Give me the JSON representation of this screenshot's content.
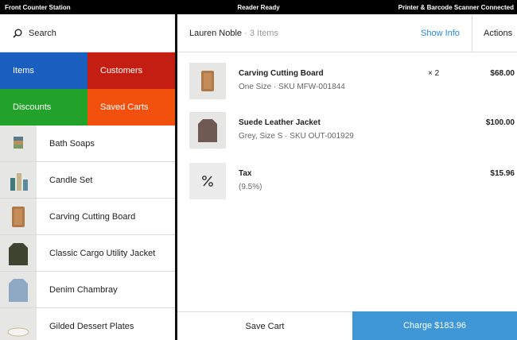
{
  "status_bar": {
    "left": "Front Counter Station",
    "center": "Reader Ready",
    "right": "Printer & Barcode Scanner Connected"
  },
  "search": {
    "label": "Search"
  },
  "tiles": {
    "items": "Items",
    "customers": "Customers",
    "discounts": "Discounts",
    "saved_carts": "Saved Carts"
  },
  "products": [
    {
      "name": "Bath Soaps"
    },
    {
      "name": "Candle Set"
    },
    {
      "name": "Carving Cutting Board"
    },
    {
      "name": "Classic Cargo Utility Jacket"
    },
    {
      "name": "Denim Chambray"
    },
    {
      "name": "Gilded Dessert Plates"
    }
  ],
  "cart": {
    "customer": "Lauren Noble",
    "item_count": " · 3 Items",
    "show_info": "Show Info",
    "actions": "Actions",
    "lines": [
      {
        "name": "Carving Cutting Board",
        "desc": "One Size · SKU MFW-001844",
        "qty": "× 2",
        "amount": "$68.00"
      },
      {
        "name": "Suede Leather Jacket",
        "desc": "Grey, Size S · SKU OUT-001929",
        "qty": "",
        "amount": "$100.00"
      },
      {
        "name": "Tax",
        "desc": "(9.5%)",
        "qty": "",
        "amount": "$15.96"
      }
    ],
    "save_cart": "Save Cart",
    "charge": "Charge $183.96"
  },
  "colors": {
    "items_tile": "#1a5fc0",
    "customers_tile": "#c41e12",
    "discounts_tile": "#22a12b",
    "saved_carts_tile": "#f2510d",
    "charge_button": "#3f97d6",
    "link": "#2a8ad3"
  },
  "icons": {
    "search": "search-icon",
    "tax": "percent-icon"
  }
}
